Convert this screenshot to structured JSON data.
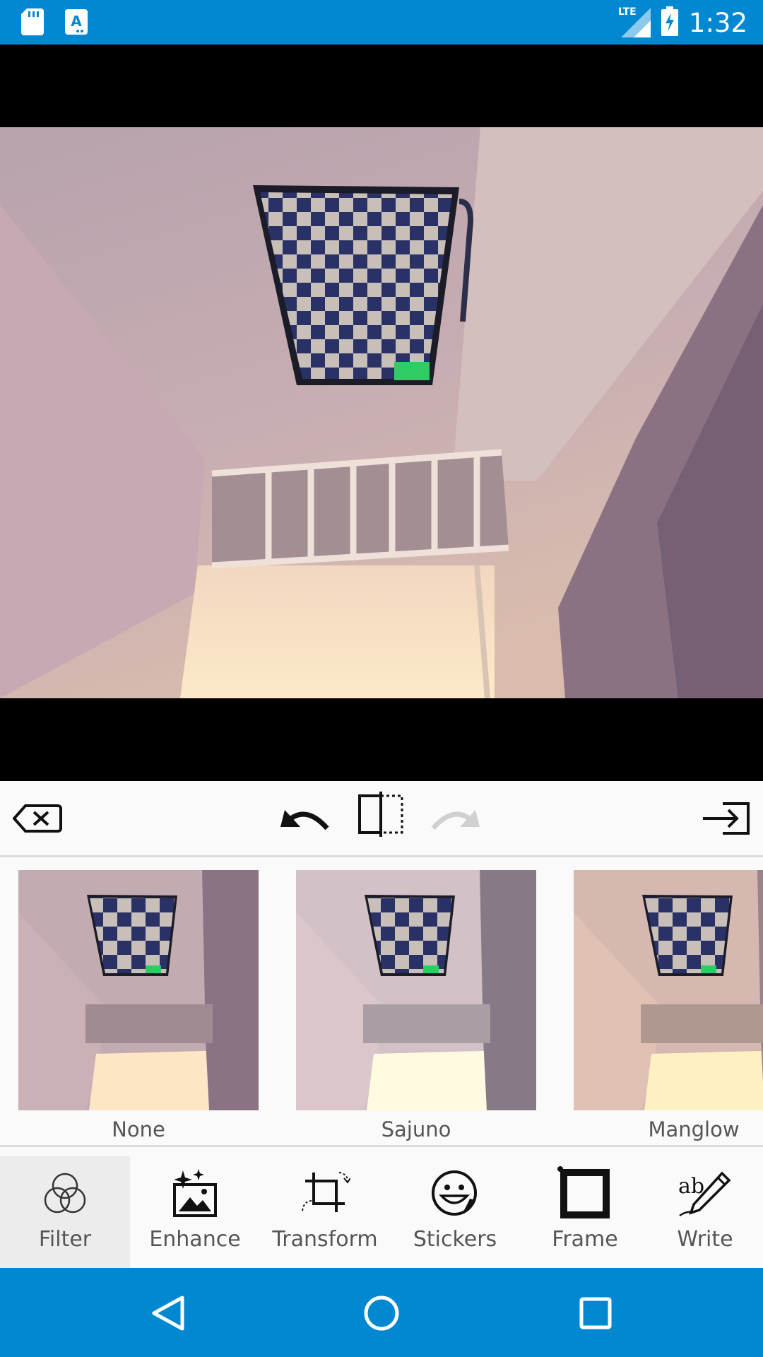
{
  "status_bar": {
    "time": "1:32",
    "network": "LTE",
    "left_icons": [
      "sd-card-icon",
      "app-a-icon"
    ],
    "right_icons": [
      "lte-signal-icon",
      "battery-charging-icon"
    ]
  },
  "toolbar": {
    "icons": [
      "discard-icon",
      "undo-icon",
      "compare-icon",
      "redo-icon",
      "export-icon"
    ]
  },
  "filters": [
    {
      "label": "None"
    },
    {
      "label": "Sajuno"
    },
    {
      "label": "Manglow"
    }
  ],
  "tools": [
    {
      "label": "Filter",
      "icon": "filter-icon",
      "active": true
    },
    {
      "label": "Enhance",
      "icon": "enhance-icon",
      "active": false
    },
    {
      "label": "Transform",
      "icon": "transform-icon",
      "active": false
    },
    {
      "label": "Stickers",
      "icon": "stickers-icon",
      "active": false
    },
    {
      "label": "Frame",
      "icon": "frame-icon",
      "active": false
    },
    {
      "label": "Write",
      "icon": "write-icon",
      "active": false
    }
  ],
  "nav_bar": {
    "icons": [
      "back-icon",
      "home-icon",
      "recents-icon"
    ]
  },
  "colors": {
    "accent": "#0288d1",
    "panel": "#fafafa",
    "active_tool_bg": "#ececec"
  }
}
